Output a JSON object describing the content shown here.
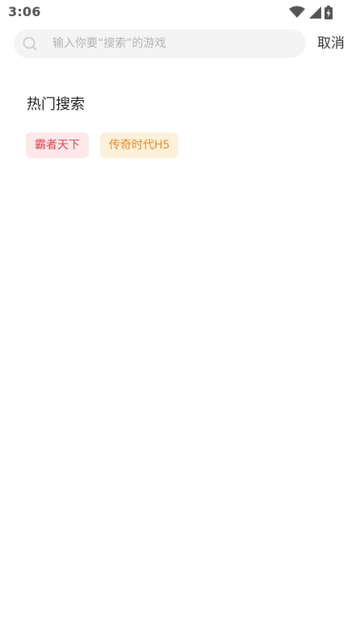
{
  "status_bar": {
    "time": "3:06",
    "icons": [
      "wifi-icon",
      "signal-icon",
      "battery-icon"
    ]
  },
  "search": {
    "placeholder": "输入你要“搜索”的游戏",
    "value": "",
    "cancel_label": "取消"
  },
  "hot_search": {
    "title": "热门搜索",
    "tags": [
      {
        "label": "霸者天下",
        "text_color": "#e0434f",
        "bg_color": "#fde8ea"
      },
      {
        "label": "传奇时代H5",
        "text_color": "#ef8a1e",
        "bg_color": "#fdf1dc"
      }
    ]
  },
  "colors": {
    "background": "#ffffff",
    "search_bg": "#f4f4f4",
    "placeholder": "#b4b4b4",
    "text_primary": "#222222"
  }
}
